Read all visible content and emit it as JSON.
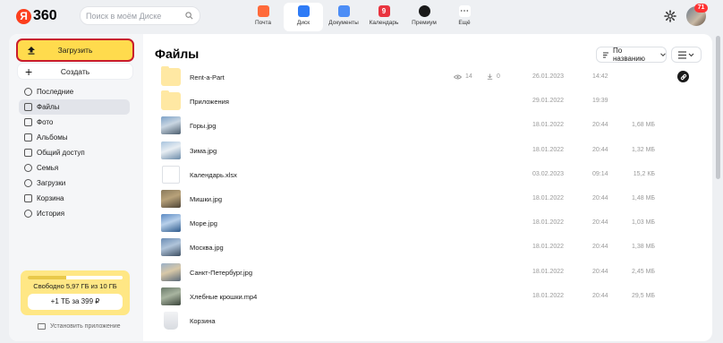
{
  "header": {
    "logo_letter": "Я",
    "logo_text": "360",
    "search_placeholder": "Поиск в моём Диске",
    "services": [
      {
        "label": "Почта",
        "icon": "mail-icon",
        "color": "#ff6a3a",
        "glyph": ""
      },
      {
        "label": "Диск",
        "icon": "disk-icon",
        "color": "#2e7bf6",
        "glyph": ""
      },
      {
        "label": "Документы",
        "icon": "documents-icon",
        "color": "#4c8df6",
        "glyph": ""
      },
      {
        "label": "Календарь",
        "icon": "calendar-icon",
        "color": "#e9343f",
        "glyph": "9"
      },
      {
        "label": "Премиум",
        "icon": "premium-icon",
        "color": "#1a1a1a",
        "glyph": ""
      },
      {
        "label": "Ещё",
        "icon": "more-icon",
        "color": "#ffffff",
        "glyph": "⋯"
      }
    ],
    "active_service": "Диск",
    "notifications_count": "71"
  },
  "sidebar": {
    "upload_label": "Загрузить",
    "create_label": "Создать",
    "items": [
      {
        "label": "Последние",
        "icon": "clock-icon"
      },
      {
        "label": "Файлы",
        "icon": "file-icon"
      },
      {
        "label": "Фото",
        "icon": "photo-icon"
      },
      {
        "label": "Альбомы",
        "icon": "album-icon"
      },
      {
        "label": "Общий доступ",
        "icon": "shared-icon"
      },
      {
        "label": "Семья",
        "icon": "family-icon"
      },
      {
        "label": "Загрузки",
        "icon": "downloads-icon"
      },
      {
        "label": "Корзина",
        "icon": "trash-icon"
      },
      {
        "label": "История",
        "icon": "history-icon"
      }
    ],
    "active_item": "Файлы",
    "storage_text": "Свободно 5,97 ГБ из 10 ГБ",
    "storage_used_fraction": 0.403,
    "buy_label": "+1 ТБ за 399 ₽",
    "install_label": "Установить приложение"
  },
  "main": {
    "title": "Файлы",
    "sort_label": "По названию",
    "files": [
      {
        "name": "Rent-a-Part",
        "type": "folder",
        "date": "26.01.2023",
        "time": "14:42",
        "size": "",
        "views": "14",
        "downloads": "0",
        "shared": true
      },
      {
        "name": "Приложения",
        "type": "folder",
        "date": "29.01.2022",
        "time": "19:39",
        "size": ""
      },
      {
        "name": "Горы.jpg",
        "type": "image",
        "thumb": [
          "#7da2c8",
          "#c9d6e2",
          "#4b5d6e"
        ],
        "date": "18.01.2022",
        "time": "20:44",
        "size": "1,68 МБ"
      },
      {
        "name": "Зима.jpg",
        "type": "image",
        "thumb": [
          "#a8c4de",
          "#e8eef3",
          "#6a8aa8"
        ],
        "date": "18.01.2022",
        "time": "20:44",
        "size": "1,32 МБ"
      },
      {
        "name": "Календарь.xlsx",
        "type": "doc",
        "date": "03.02.2023",
        "time": "09:14",
        "size": "15,2 КБ"
      },
      {
        "name": "Мишки.jpg",
        "type": "image",
        "thumb": [
          "#8a7a5c",
          "#b8a27a",
          "#4e4436"
        ],
        "date": "18.01.2022",
        "time": "20:44",
        "size": "1,48 МБ"
      },
      {
        "name": "Море.jpg",
        "type": "image",
        "thumb": [
          "#5a8ac4",
          "#b8d0ea",
          "#2e5a8c"
        ],
        "date": "18.01.2022",
        "time": "20:44",
        "size": "1,03 МБ"
      },
      {
        "name": "Москва.jpg",
        "type": "image",
        "thumb": [
          "#6a8cb4",
          "#b0c4da",
          "#3c4e62"
        ],
        "date": "18.01.2022",
        "time": "20:44",
        "size": "1,38 МБ"
      },
      {
        "name": "Санкт-Петербург.jpg",
        "type": "image",
        "thumb": [
          "#9ab0c8",
          "#d8c8a8",
          "#5a6a7a"
        ],
        "date": "18.01.2022",
        "time": "20:44",
        "size": "2,45 МБ"
      },
      {
        "name": "Хлебные крошки.mp4",
        "type": "image",
        "thumb": [
          "#6a7a6a",
          "#a8b4a0",
          "#3a443a"
        ],
        "date": "18.01.2022",
        "time": "20:44",
        "size": "29,5 МБ"
      },
      {
        "name": "Корзина",
        "type": "trash",
        "date": "",
        "time": "",
        "size": ""
      }
    ]
  }
}
